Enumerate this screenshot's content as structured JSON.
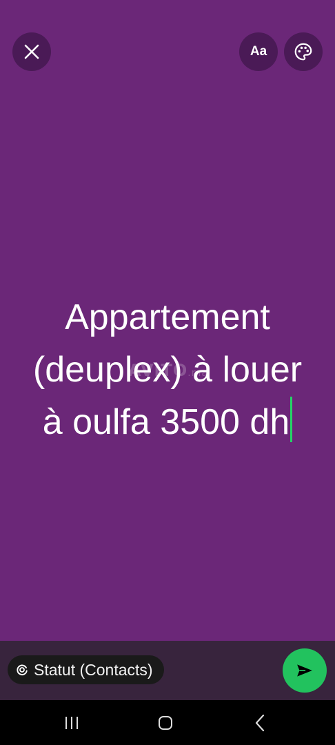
{
  "toolbar": {
    "close_icon": "close-icon",
    "font_label": "Aa",
    "palette_icon": "palette-icon"
  },
  "status": {
    "lines": [
      "Appartement",
      "(deuplex) à louer",
      "à oulfa 3500 dh"
    ],
    "background_color": "#6b2778",
    "caret_color": "#25d366"
  },
  "watermark": {
    "text": "AVITO",
    "suffix": ".ma"
  },
  "composer": {
    "audience_label": "Statut (Contacts)",
    "audience_icon": "privacy-ring-icon",
    "send_icon": "send-icon",
    "send_color": "#22c25e"
  },
  "navigation": {
    "recents_icon": "recents-icon",
    "home_icon": "home-icon",
    "back_icon": "back-icon"
  }
}
